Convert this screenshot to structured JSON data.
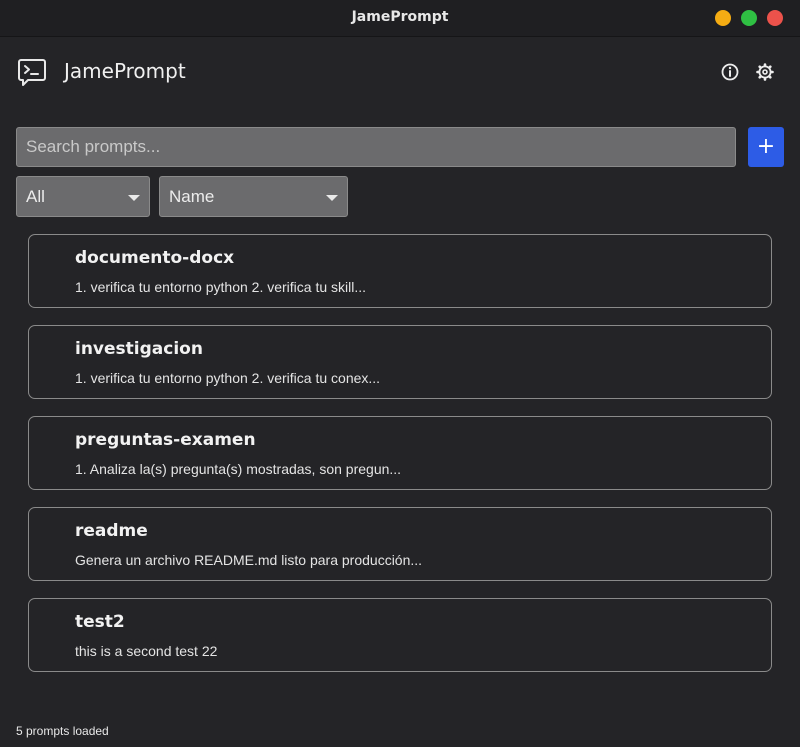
{
  "window": {
    "title": "JamePrompt"
  },
  "header": {
    "app_name": "JamePrompt",
    "logo_icon": "terminal-chat-icon",
    "info_icon": "info-icon",
    "settings_icon": "gear-icon"
  },
  "search": {
    "placeholder": "Search prompts...",
    "value": "",
    "add_label": "+"
  },
  "filters": {
    "category": "All",
    "sort": "Name"
  },
  "prompts": [
    {
      "name": "documento-docx",
      "preview": "1. verifica tu entorno python 2. verifica tu skill..."
    },
    {
      "name": "investigacion",
      "preview": "1. verifica tu entorno python 2. verifica tu conex..."
    },
    {
      "name": "preguntas-examen",
      "preview": "1. Analiza la(s) pregunta(s) mostradas, son pregun..."
    },
    {
      "name": "readme",
      "preview": "Genera un archivo README.md listo para producción..."
    },
    {
      "name": "test2",
      "preview": "this is a second test 22"
    }
  ],
  "status": {
    "text": "5 prompts loaded"
  },
  "colors": {
    "background": "#242427",
    "accent": "#2d5ce6",
    "minimize": "#f5ac13",
    "maximize": "#2fc043",
    "close": "#ec524b"
  }
}
